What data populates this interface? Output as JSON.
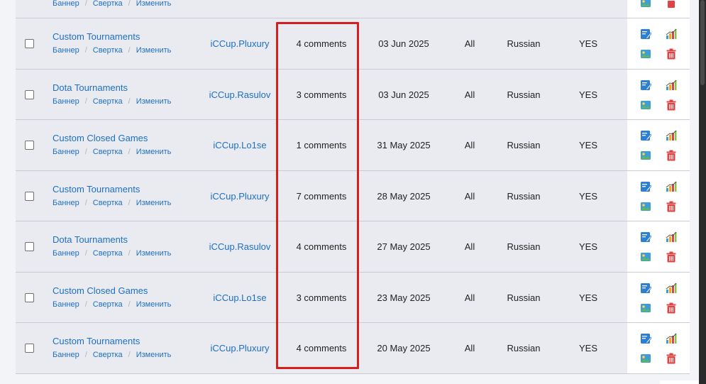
{
  "row_links": {
    "banner": "Баннер",
    "collapse": "Свертка",
    "edit": "Изменить"
  },
  "colors": {
    "link": "#1d6fc4",
    "highlight": "#d61e1e",
    "row_bg": "#e9ebf0",
    "trash": "#e04343"
  },
  "icons": {
    "edit": "edit-note-icon",
    "stats": "bar-chart-icon",
    "image": "image-icon",
    "delete": "trash-icon"
  },
  "rows": [
    {
      "title": "Custom Tournaments",
      "author": "iCCup.Pluxury",
      "comments": "4 comments",
      "date": "03 Jun 2025",
      "scope": "All",
      "language": "Russian",
      "active": "YES"
    },
    {
      "title": "Dota Tournaments",
      "author": "iCCup.Rasulov",
      "comments": "3 comments",
      "date": "03 Jun 2025",
      "scope": "All",
      "language": "Russian",
      "active": "YES"
    },
    {
      "title": "Custom Closed Games",
      "author": "iCCup.Lo1se",
      "comments": "1 comments",
      "date": "31 May 2025",
      "scope": "All",
      "language": "Russian",
      "active": "YES"
    },
    {
      "title": "Custom Tournaments",
      "author": "iCCup.Pluxury",
      "comments": "7 comments",
      "date": "28 May 2025",
      "scope": "All",
      "language": "Russian",
      "active": "YES"
    },
    {
      "title": "Dota Tournaments",
      "author": "iCCup.Rasulov",
      "comments": "4 comments",
      "date": "27 May 2025",
      "scope": "All",
      "language": "Russian",
      "active": "YES"
    },
    {
      "title": "Custom Closed Games",
      "author": "iCCup.Lo1se",
      "comments": "3 comments",
      "date": "23 May 2025",
      "scope": "All",
      "language": "Russian",
      "active": "YES"
    },
    {
      "title": "Custom Tournaments",
      "author": "iCCup.Pluxury",
      "comments": "4 comments",
      "date": "20 May 2025",
      "scope": "All",
      "language": "Russian",
      "active": "YES"
    }
  ]
}
